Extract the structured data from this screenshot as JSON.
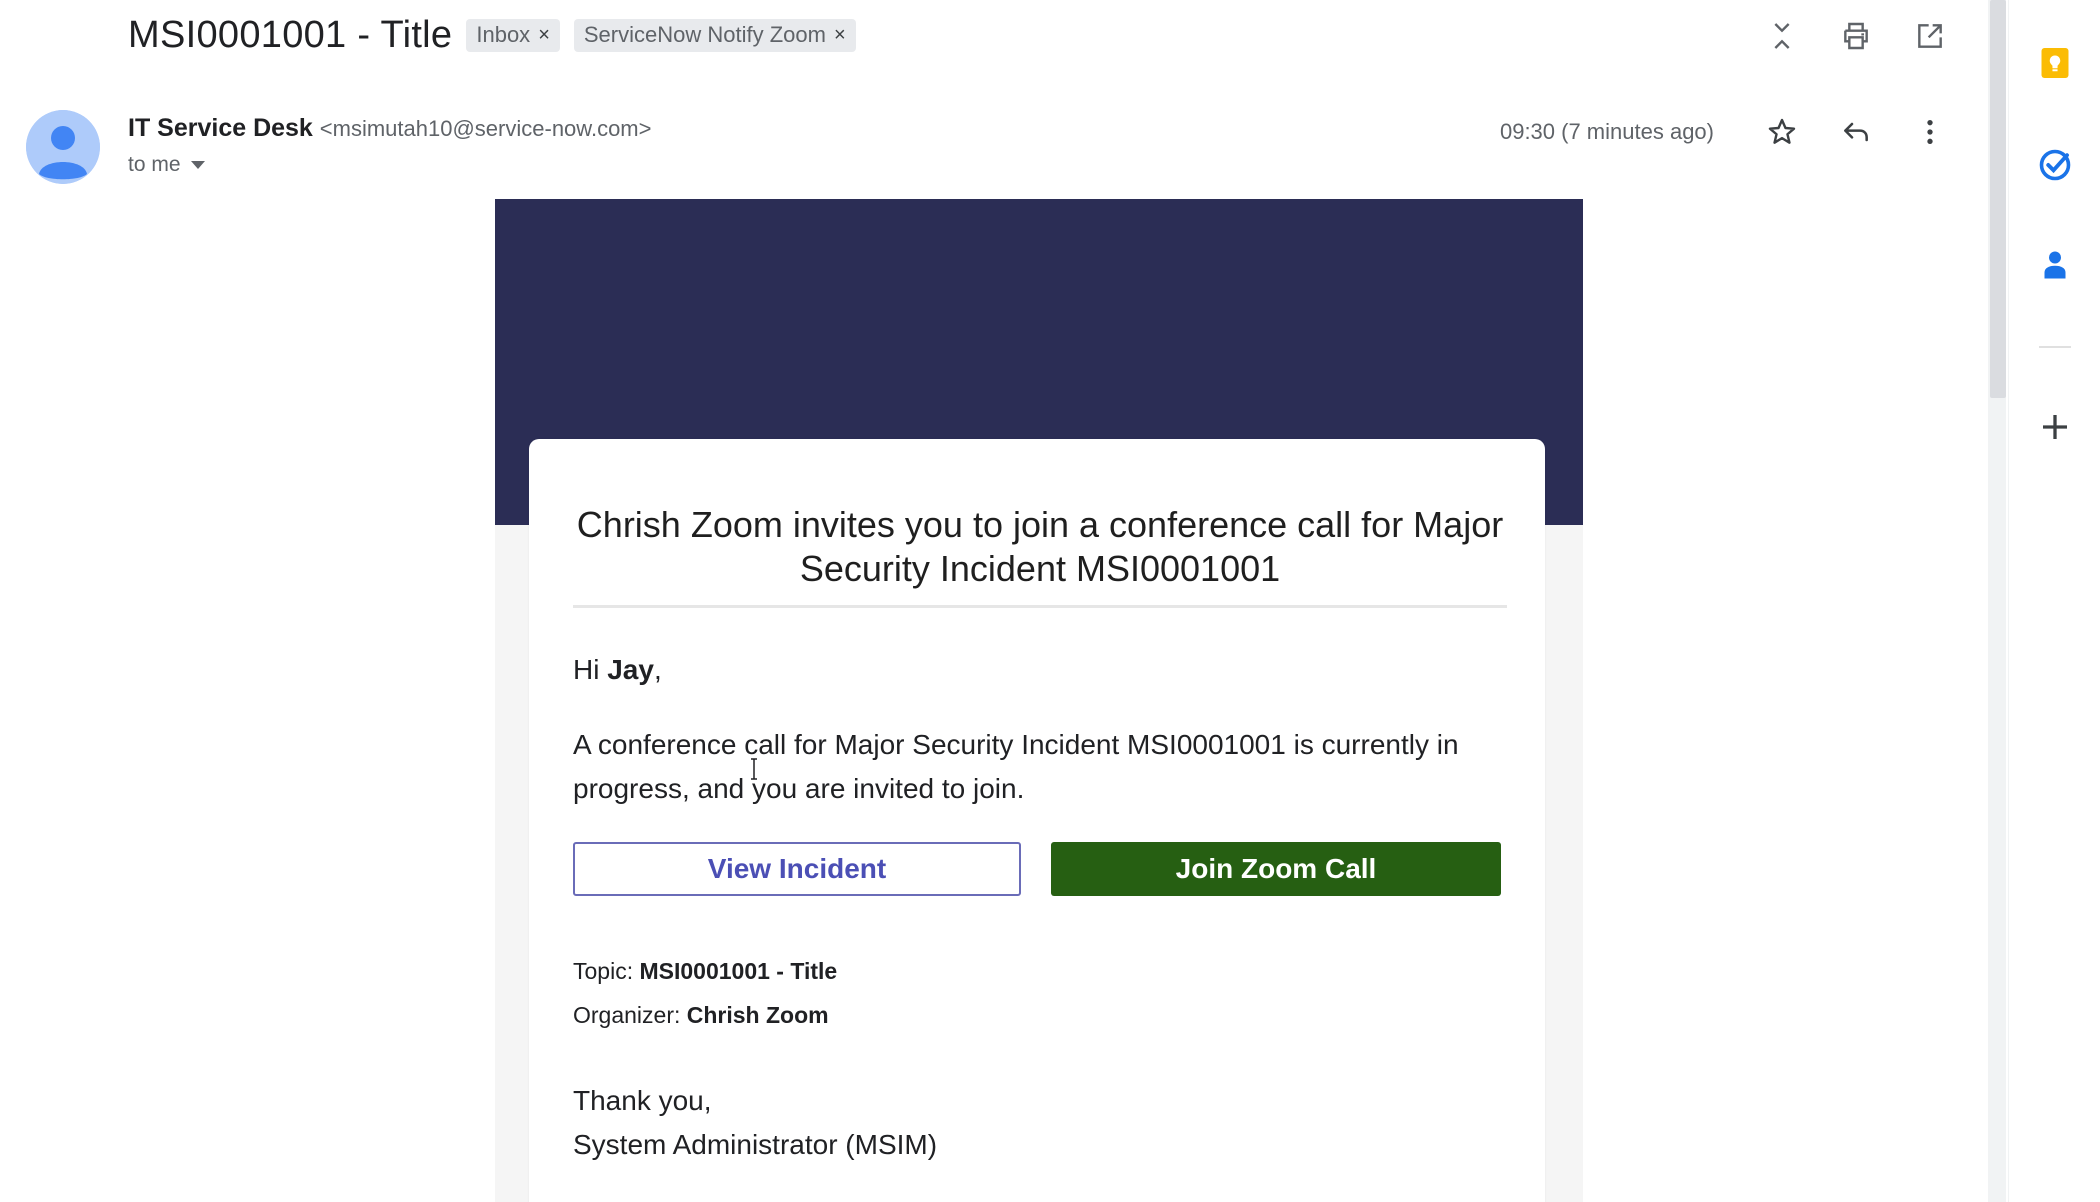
{
  "header": {
    "subject": "MSI0001001 - Title",
    "labels": [
      {
        "name": "Inbox",
        "remove": "×"
      },
      {
        "name": "ServiceNow Notify Zoom",
        "remove": "×"
      }
    ],
    "actions": [
      "expand-collapse-icon",
      "print-icon",
      "open-new-window-icon"
    ]
  },
  "message_header": {
    "sender_name": "IT Service Desk",
    "sender_email": "<msimutah10@service-now.com>",
    "recipient": "to me",
    "timestamp": "09:30 (7 minutes ago)",
    "actions": [
      "star-icon",
      "reply-icon",
      "more-vert-icon"
    ]
  },
  "email": {
    "heading": "Chrish Zoom invites you to join a conference call for Major Security Incident MSI0001001",
    "greeting_prefix": "Hi ",
    "greeting_name": "Jay",
    "greeting_suffix": ",",
    "message": "A conference call for Major Security Incident MSI0001001 is currently in progress, and you are invited to join.",
    "view_button": "View Incident",
    "join_button": "Join Zoom Call",
    "topic_label": "Topic: ",
    "topic_value": "MSI0001001 - Title",
    "organizer_label": "Organizer: ",
    "organizer_value": "Chrish Zoom",
    "signoff_line1": "Thank you,",
    "signoff_line2": "System Administrator (MSIM)"
  },
  "side_rail": {
    "icons": [
      "keep-icon",
      "tasks-icon",
      "contacts-icon",
      "add-addon-icon"
    ]
  },
  "colors": {
    "banner": "#2b2d55",
    "join_button": "#265f12",
    "view_button_text": "#4b4fb5",
    "keep": "#fbbc04",
    "tasks": "#1a73e8",
    "contacts": "#1a73e8"
  }
}
